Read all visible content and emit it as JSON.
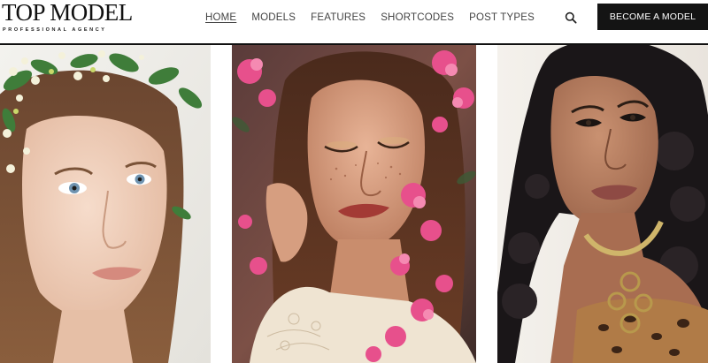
{
  "brand": {
    "name": "TOP MODEL",
    "tagline": "PROFESSIONAL AGENCY"
  },
  "nav": {
    "items": [
      {
        "label": "HOME",
        "active": true
      },
      {
        "label": "MODELS",
        "active": false
      },
      {
        "label": "FEATURES",
        "active": false
      },
      {
        "label": "SHORTCODES",
        "active": false
      },
      {
        "label": "POST TYPES",
        "active": false
      }
    ]
  },
  "search": {
    "icon": "search-icon"
  },
  "cta": {
    "label": "BECOME A MODEL"
  },
  "colors": {
    "cta_background": "#141414",
    "divider": "#111111",
    "nav_text": "#444444"
  },
  "gallery": {
    "items": [
      {
        "description_icon": "model-portrait-flower-crown"
      },
      {
        "description_icon": "model-portrait-pink-blossoms"
      },
      {
        "description_icon": "model-portrait-dark-curly-hair"
      }
    ]
  }
}
